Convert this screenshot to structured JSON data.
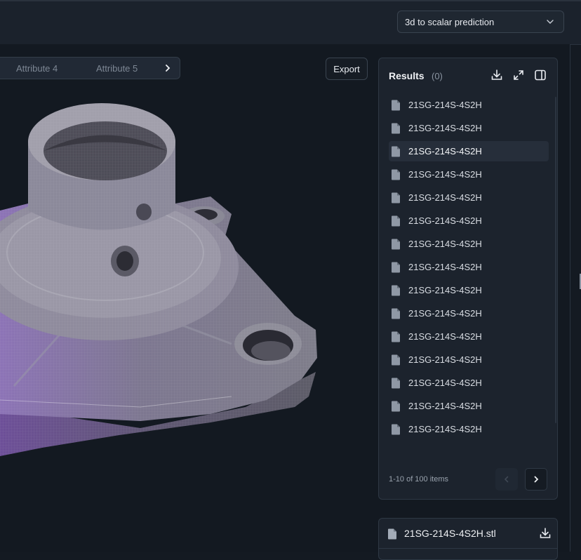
{
  "header": {
    "model_select": {
      "value": "3d to scalar prediction",
      "icon": "chevron-down-icon"
    }
  },
  "viewer": {
    "tabs": [
      {
        "label": "Attribute 4"
      },
      {
        "label": "Attribute 5"
      }
    ],
    "next_icon": "chevron-right-icon",
    "export_label": "Export"
  },
  "results": {
    "title": "Results",
    "count": "(0)",
    "actions": [
      "download-icon",
      "expand-icon",
      "panel-toggle-icon"
    ],
    "items": [
      "21SG-214S-4S2H",
      "21SG-214S-4S2H",
      "21SG-214S-4S2H",
      "21SG-214S-4S2H",
      "21SG-214S-4S2H",
      "21SG-214S-4S2H",
      "21SG-214S-4S2H",
      "21SG-214S-4S2H",
      "21SG-214S-4S2H",
      "21SG-214S-4S2H",
      "21SG-214S-4S2H",
      "21SG-214S-4S2H",
      "21SG-214S-4S2H",
      "21SG-214S-4S2H",
      "21SG-214S-4S2H"
    ],
    "selected_index": 2,
    "pagination": {
      "text": "1-10 of 100 items"
    }
  },
  "file_card": {
    "name": "21SG-214S-4S2H.stl",
    "icon": "download-icon"
  },
  "colors": {
    "background": "#141a22",
    "panel": "#1c232d",
    "selected_row": "#262e3a",
    "mesh_purple": "#7a62a3"
  }
}
